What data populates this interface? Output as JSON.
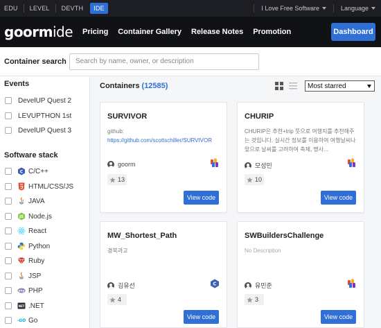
{
  "topbar": {
    "links": [
      "EDU",
      "LEVEL",
      "DEVTH",
      "IDE"
    ],
    "active_link": "IDE",
    "love_label": "I Love Free Software",
    "language_label": "Language"
  },
  "nav": {
    "logo_part1": "goorm",
    "logo_part2": "ide",
    "links": [
      "Pricing",
      "Container Gallery",
      "Release Notes",
      "Promotion"
    ],
    "dashboard_label": "Dashboard"
  },
  "search": {
    "label": "Container search",
    "placeholder": "Search by name, owner, or description",
    "value": ""
  },
  "sidebar": {
    "events_title": "Events",
    "events": [
      "DevelUP Quest 2",
      "LEVUPTHON 1st",
      "DevelUP Quest 3"
    ],
    "stack_title": "Software stack",
    "stacks": [
      {
        "label": "C/C++",
        "icon": "cpp-icon"
      },
      {
        "label": "HTML/CSS/JS",
        "icon": "html5-icon"
      },
      {
        "label": "JAVA",
        "icon": "java-icon"
      },
      {
        "label": "Node.js",
        "icon": "nodejs-icon"
      },
      {
        "label": "React",
        "icon": "react-icon"
      },
      {
        "label": "Python",
        "icon": "python-icon"
      },
      {
        "label": "Ruby",
        "icon": "ruby-icon"
      },
      {
        "label": "JSP",
        "icon": "jsp-icon"
      },
      {
        "label": "PHP",
        "icon": "php-icon"
      },
      {
        "label": ".NET",
        "icon": "dotnet-icon"
      },
      {
        "label": "Go",
        "icon": "go-icon"
      }
    ]
  },
  "main": {
    "title": "Containers",
    "count": "(12585)",
    "sort_selected": "Most starred",
    "view_code_label": "View code",
    "cards": [
      {
        "title": "SURVIVOR",
        "desc_line1": "github:",
        "desc_link": "https://github.com/scottschiller/SURVIVOR",
        "owner": "goorm",
        "stars": "13",
        "stack_icon": "blank-stack-icon"
      },
      {
        "title": "CHURIP",
        "desc_text": "CHURIP은 추천+trip 뜻으로 여행지를 추천해주는 것입니다. 실시간 정보를 이용하여 여행날씨나 앞으로 날씨를 고려하여 축제, 명사...",
        "owner": "모성민",
        "stars": "10",
        "stack_icon": "blank-stack-icon"
      },
      {
        "title": "MW_Shortest_Path",
        "desc_text": "경북과고",
        "owner": "김유선",
        "stars": "4",
        "stack_icon": "cpp-icon"
      },
      {
        "title": "SWBuildersChallenge",
        "desc_text": "No Description",
        "owner": "유민준",
        "stars": "3",
        "stack_icon": "blank-stack-icon"
      }
    ]
  },
  "colors": {
    "accent": "#2f6fd6",
    "topbar_bg": "#1d1e24",
    "nav_bg": "#111216"
  }
}
